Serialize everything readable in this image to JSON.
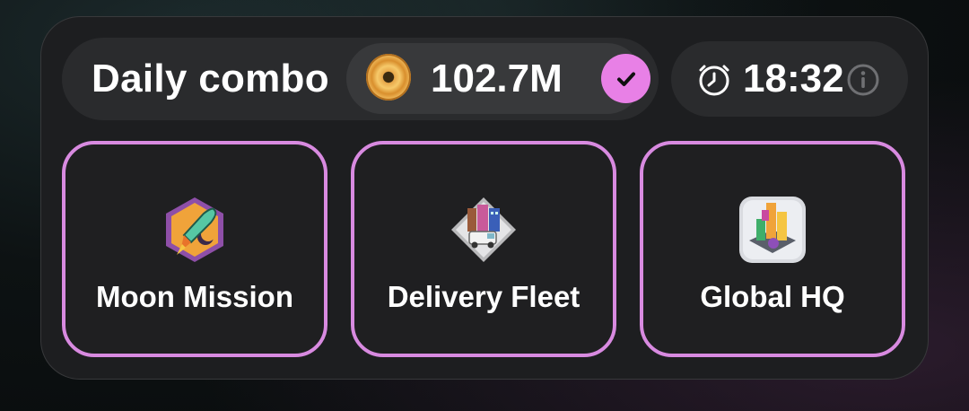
{
  "daily_combo": {
    "title": "Daily combo",
    "reward": {
      "amount": "102.7M",
      "icon": "coin-icon",
      "claimed_icon": "check-icon"
    },
    "timer": {
      "time": "18:32",
      "icon": "clock-icon",
      "info_icon": "info-icon"
    },
    "cards": [
      {
        "label": "Moon Mission",
        "icon": "rocket-icon"
      },
      {
        "label": "Delivery Fleet",
        "icon": "delivery-truck-icon"
      },
      {
        "label": "Global HQ",
        "icon": "building-blocks-icon"
      }
    ]
  },
  "colors": {
    "accent_pink": "#e880e6",
    "card_border": "#d88ae0",
    "panel_bg": "#1d1e20",
    "pill_bg": "#2a2b2d",
    "coin_gold": "#f0b14e",
    "text": "#ffffff"
  }
}
